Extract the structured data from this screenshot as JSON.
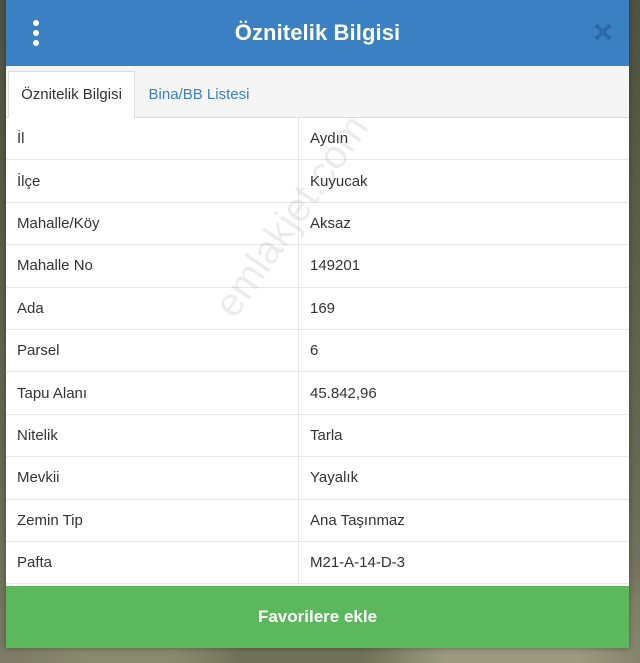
{
  "dialog": {
    "title": "Öznitelik Bilgisi",
    "favorite_button_label": "Favorilere ekle"
  },
  "tabs": [
    {
      "label": "Öznitelik Bilgisi",
      "active": true
    },
    {
      "label": "Bina/BB Listesi",
      "active": false
    }
  ],
  "rows": [
    {
      "key": "İl",
      "value": "Aydın"
    },
    {
      "key": "İlçe",
      "value": "Kuyucak"
    },
    {
      "key": "Mahalle/Köy",
      "value": "Aksaz"
    },
    {
      "key": "Mahalle No",
      "value": "149201"
    },
    {
      "key": "Ada",
      "value": "169"
    },
    {
      "key": "Parsel",
      "value": "6"
    },
    {
      "key": "Tapu Alanı",
      "value": "45.842,96"
    },
    {
      "key": "Nitelik",
      "value": "Tarla"
    },
    {
      "key": "Mevkii",
      "value": "Yayalık"
    },
    {
      "key": "Zemin Tip",
      "value": "Ana Taşınmaz"
    },
    {
      "key": "Pafta",
      "value": "M21-A-14-D-3"
    }
  ],
  "watermark": "emlakjet.com",
  "icons": {
    "menu": "vertical-dots-menu-icon",
    "close": "close-x-icon"
  },
  "colors": {
    "header": "#3a80c2",
    "button": "#5cb85c",
    "tab_link": "#3a80c2"
  }
}
